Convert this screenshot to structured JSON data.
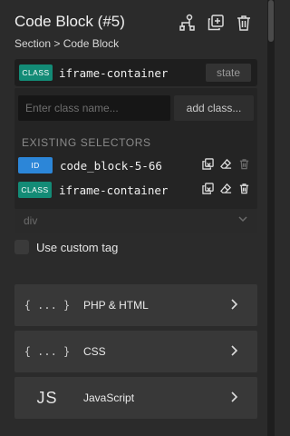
{
  "header": {
    "title": "Code Block (#5)",
    "breadcrumb": "Section > Code Block"
  },
  "selector": {
    "badge": "CLASS",
    "name": "iframe-container",
    "state_label": "state"
  },
  "dropdown": {
    "input_placeholder": "Enter class name...",
    "add_label": "add class...",
    "existing_heading": "EXISTING SELECTORS",
    "items": [
      {
        "badge": "ID",
        "name": "code_block-5-66"
      },
      {
        "badge": "CLASS",
        "name": "iframe-container"
      }
    ]
  },
  "tag": {
    "value": "div"
  },
  "custom_tag": {
    "label": "Use custom tag"
  },
  "code_sections": [
    {
      "icon": "{ ... }",
      "label": "PHP & HTML"
    },
    {
      "icon": "{ ... }",
      "label": "CSS"
    },
    {
      "icon": "JS",
      "label": "JavaScript"
    }
  ],
  "colors": {
    "class_badge": "#138b76",
    "id_badge": "#2c86d8",
    "background": "#2b2b2b"
  }
}
